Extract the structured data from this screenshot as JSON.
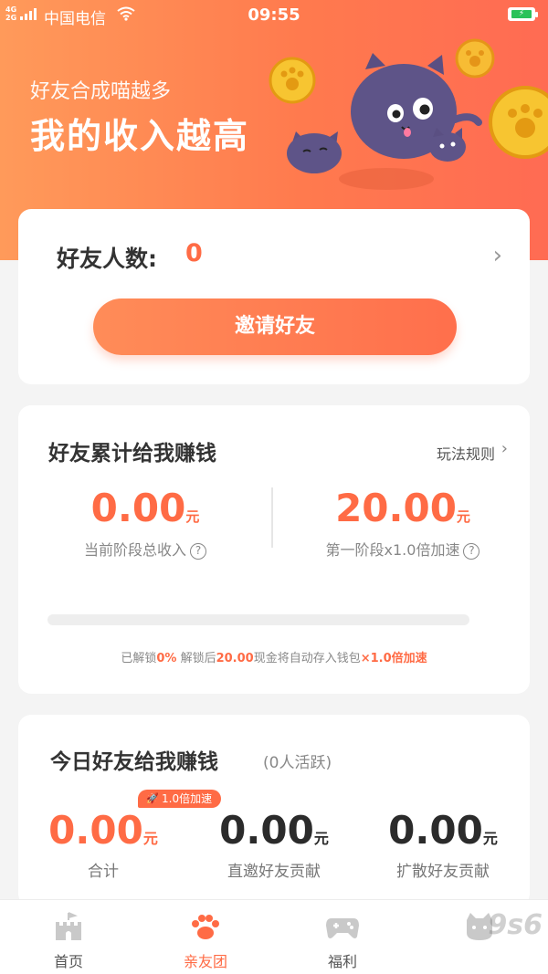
{
  "status_bar": {
    "network": "4G",
    "network2": "2G",
    "carrier": "中国电信",
    "time": "09:55",
    "battery_state": "charging"
  },
  "hero": {
    "subtitle": "好友合成喵越多",
    "title": "我的收入越高"
  },
  "friends_card": {
    "label": "好友人数:",
    "count": "0",
    "invite_button": "邀请好友"
  },
  "earnings_card": {
    "title": "好友累计给我赚钱",
    "rules_link": "玩法规则",
    "stats": [
      {
        "value": "0.00",
        "unit": "元",
        "caption": "当前阶段总收入"
      },
      {
        "value": "20.00",
        "unit": "元",
        "caption": "第一阶段x1.0倍加速"
      }
    ],
    "progress_fraction": 0,
    "note": {
      "t1": "已解锁",
      "pct": "0%",
      "t2": " 解锁后",
      "amount": "20.00",
      "t3": "现金将自动存入钱包",
      "mult": "×1.0倍加速"
    }
  },
  "today_card": {
    "title": "今日好友给我赚钱",
    "active": "(0人活跃)",
    "speed_badge": "1.0倍加速",
    "stats": [
      {
        "value": "0.00",
        "unit": "元",
        "caption": "合计"
      },
      {
        "value": "0.00",
        "unit": "元",
        "caption": "直邀好友贡献"
      },
      {
        "value": "0.00",
        "unit": "元",
        "caption": "扩散好友贡献"
      }
    ]
  },
  "tabbar": {
    "items": [
      {
        "label": "首页",
        "icon": "castle-icon"
      },
      {
        "label": "亲友团",
        "icon": "paw-icon"
      },
      {
        "label": "福利",
        "icon": "gamepad-icon"
      },
      {
        "label": "",
        "icon": "cat-face-icon"
      }
    ],
    "active_index": 1
  },
  "watermark": "9s6",
  "colors": {
    "accent": "#ff6b45",
    "hero_gradient_start": "#ff9a5a",
    "hero_gradient_end": "#ff6b53",
    "active_tab": "#ff6b45"
  }
}
